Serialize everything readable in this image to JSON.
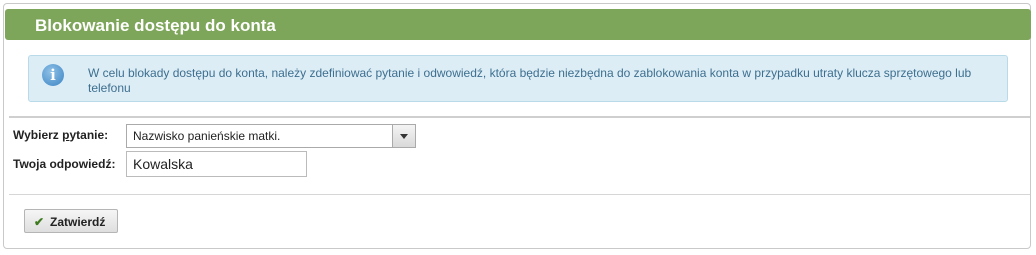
{
  "header": {
    "title": "Blokowanie dostępu do konta"
  },
  "info": {
    "icon": "info-icon",
    "icon_glyph": "i",
    "text": "W celu blokady dostępu do konta, należy zdefiniować pytanie i odwowiedź, która będzie niezbędna do zablokowania konta w przypadku utraty klucza sprzętowego lub telefonu"
  },
  "form": {
    "question_label_pre": "Wybierz ",
    "question_label_accel": "p",
    "question_label_post": "ytanie:",
    "question_selected": "Nazwisko panieńskie matki.",
    "answer_label": "Twoja odpowiedź:",
    "answer_value": "Kowalska"
  },
  "actions": {
    "submit_icon": "check-icon",
    "submit_label": "Zatwierdź"
  },
  "colors": {
    "header_bg": "#7ea65a",
    "info_bg": "#dcedf6",
    "info_text": "#3e6f8f"
  }
}
